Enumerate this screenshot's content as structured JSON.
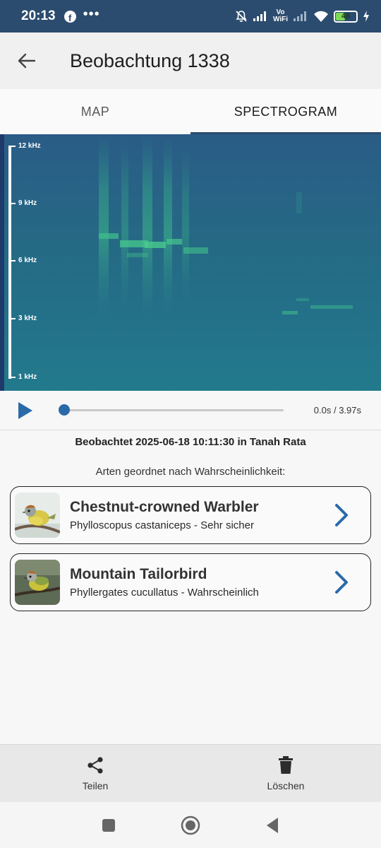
{
  "status_bar": {
    "time": "20:13",
    "vowifi_top": "Vo",
    "vowifi_bottom": "WiFi",
    "battery_level": 48,
    "battery_text": "48"
  },
  "app_bar": {
    "title": "Beobachtung 1338"
  },
  "tabs": [
    {
      "label": "MAP",
      "active": false
    },
    {
      "label": "SPECTROGRAM",
      "active": true
    }
  ],
  "spectrogram": {
    "freq_labels": [
      "12 kHz",
      "9 kHz",
      "6 kHz",
      "3 kHz",
      "1 kHz"
    ]
  },
  "player": {
    "progress": 0,
    "time": "0.0s / 3.97s"
  },
  "observation": {
    "observed_text": "Beobachtet 2025-06-18 10:11:30 in Tanah Rata",
    "list_heading": "Arten geordnet nach Wahrscheinlichkeit:"
  },
  "species": [
    {
      "name": "Chestnut-crowned Warbler",
      "subtitle": "Phylloscopus castaniceps - Sehr sicher"
    },
    {
      "name": "Mountain Tailorbird",
      "subtitle": "Phyllergates cucullatus - Wahrscheinlich"
    }
  ],
  "actions": {
    "share": "Teilen",
    "delete": "Löschen"
  },
  "colors": {
    "status_bar": "#2b4c6e",
    "accent": "#2a6aa8",
    "spectrogram_bg": "#26597f",
    "battery": "#7ed957"
  }
}
